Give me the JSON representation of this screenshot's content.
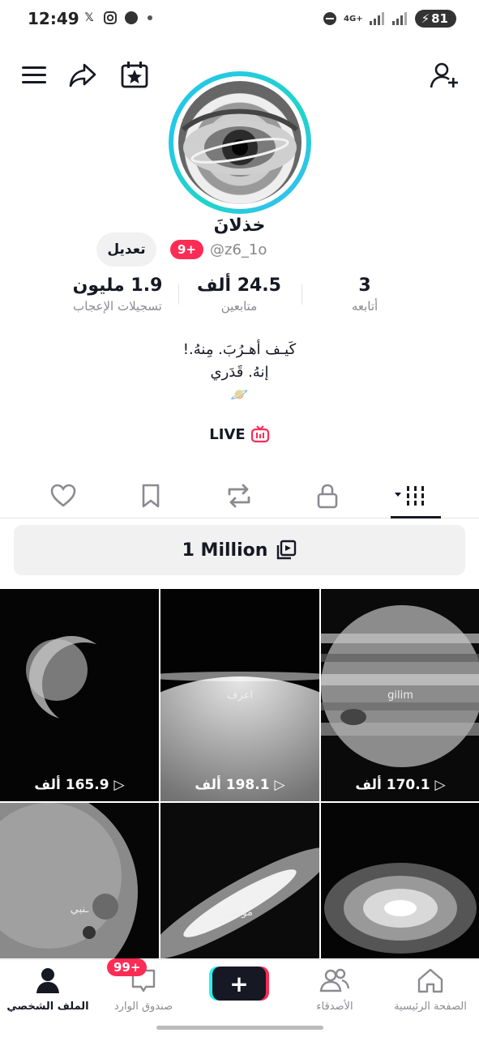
{
  "status_bar": {
    "time": "12:49",
    "network": "4G+",
    "battery": "81"
  },
  "profile": {
    "display_name": "خذلانَ",
    "username": "@z6_1o",
    "badge": "9+",
    "edit_label": "تعديل",
    "stats": [
      {
        "value": "1.9 مليون",
        "label": "تسجيلات الإعجاب"
      },
      {
        "value": "24.5 ألف",
        "label": "متابعين"
      },
      {
        "value": "3",
        "label": "أتابعه"
      }
    ],
    "bio_line1": "كَيـف أهـرُبَ. مِنهُ.!",
    "bio_line2": "إنهُ. قَدَري",
    "bio_emoji": "🪐",
    "live_label": "LIVE"
  },
  "tabs": [
    "liked-tab",
    "favorites-tab",
    "reposts-tab",
    "private-tab",
    "videos-tab"
  ],
  "playlist": {
    "label": "1 Million"
  },
  "videos": [
    {
      "views": "165.9 ألف",
      "caption": ""
    },
    {
      "views": "198.1 ألف",
      "caption": "اعرف"
    },
    {
      "views": "170.1 ألف",
      "caption": "gilim"
    },
    {
      "views": "",
      "caption": "ـنبي"
    },
    {
      "views": "",
      "caption": "موتني"
    },
    {
      "views": "",
      "caption": ""
    }
  ],
  "bottom_nav": {
    "profile": "الملف الشخصي",
    "inbox": "صندوق الوارد",
    "inbox_badge": "99+",
    "friends": "الأصدقاء",
    "home": "الصفحة الرئيسية"
  },
  "colors": {
    "accent": "#fe2c55",
    "cyan": "#25f4ee"
  }
}
